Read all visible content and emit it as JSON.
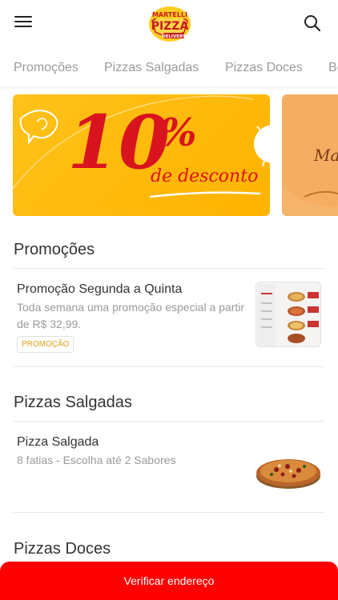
{
  "header": {
    "logo_top": "MARTELLI",
    "logo_mid": "PIZZA",
    "logo_bottom": "DELIVERY"
  },
  "tabs": [
    {
      "label": "Promoções"
    },
    {
      "label": "Pizzas Salgadas"
    },
    {
      "label": "Pizzas Doces"
    },
    {
      "label": "Be"
    }
  ],
  "banners": [
    {
      "big": "10",
      "pct": "%",
      "script": "de desconto"
    },
    {
      "script": "Ma"
    }
  ],
  "sections": [
    {
      "title": "Promoções",
      "items": [
        {
          "name": "Promoção Segunda a Quinta",
          "description": "Toda semana uma promoção especial a partir de R$ 32,99.",
          "badge": "PROMOÇÃO"
        }
      ]
    },
    {
      "title": "Pizzas Salgadas",
      "items": [
        {
          "name": "Pizza Salgada",
          "description": "8 fatias - Escolha até 2 Sabores"
        }
      ]
    },
    {
      "title": "Pizzas Doces",
      "items": []
    }
  ],
  "cta": {
    "label": "Verificar endereço"
  },
  "colors": {
    "accent": "#ff0000",
    "banner_yellow": "#ffc21a",
    "badge_text": "#e0a11b"
  }
}
